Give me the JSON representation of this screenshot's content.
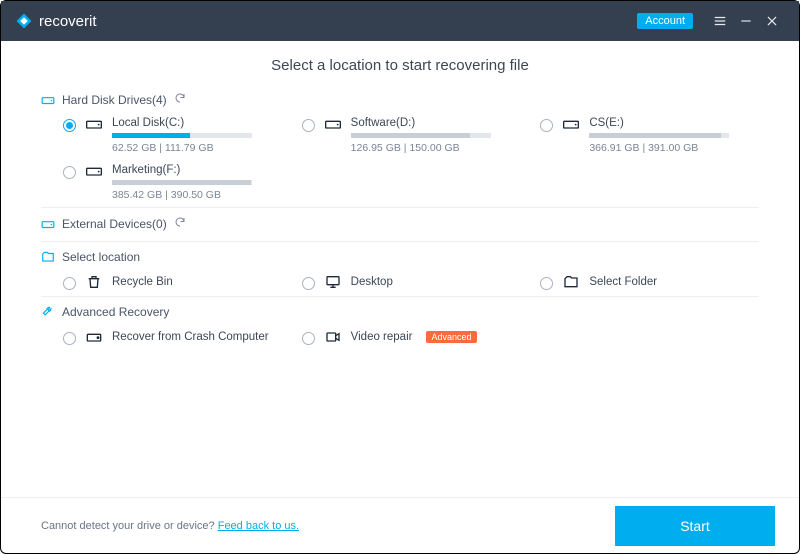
{
  "app": {
    "name": "recoverit"
  },
  "titlebar": {
    "account_label": "Account"
  },
  "headline": "Select a location to start recovering file",
  "sections": {
    "hdd": {
      "title": "Hard Disk Drives(4)",
      "drives": [
        {
          "name": "Local Disk(C:)",
          "used": 62.52,
          "total": 111.79,
          "size_text": "62.52  GB | 111.79  GB",
          "selected": true
        },
        {
          "name": "Software(D:)",
          "used": 126.95,
          "total": 150.0,
          "size_text": "126.95  GB | 150.00  GB",
          "selected": false
        },
        {
          "name": "CS(E:)",
          "used": 366.91,
          "total": 391.0,
          "size_text": "366.91  GB | 391.00  GB",
          "selected": false
        },
        {
          "name": "Marketing(F:)",
          "used": 385.42,
          "total": 390.5,
          "size_text": "385.42  GB | 390.50  GB",
          "selected": false
        }
      ]
    },
    "external": {
      "title": "External Devices(0)"
    },
    "select_location": {
      "title": "Select location",
      "items": [
        {
          "name": "Recycle Bin",
          "icon": "recycle-bin"
        },
        {
          "name": "Desktop",
          "icon": "desktop"
        },
        {
          "name": "Select Folder",
          "icon": "folder"
        }
      ]
    },
    "advanced": {
      "title": "Advanced Recovery",
      "items": [
        {
          "name": "Recover from Crash Computer",
          "icon": "hdd",
          "badge": null
        },
        {
          "name": "Video repair",
          "icon": "video",
          "badge": "Advanced"
        }
      ]
    }
  },
  "footer": {
    "note_prefix": "Cannot detect your drive or device? ",
    "note_link": "Feed back to us.",
    "start_label": "Start"
  }
}
